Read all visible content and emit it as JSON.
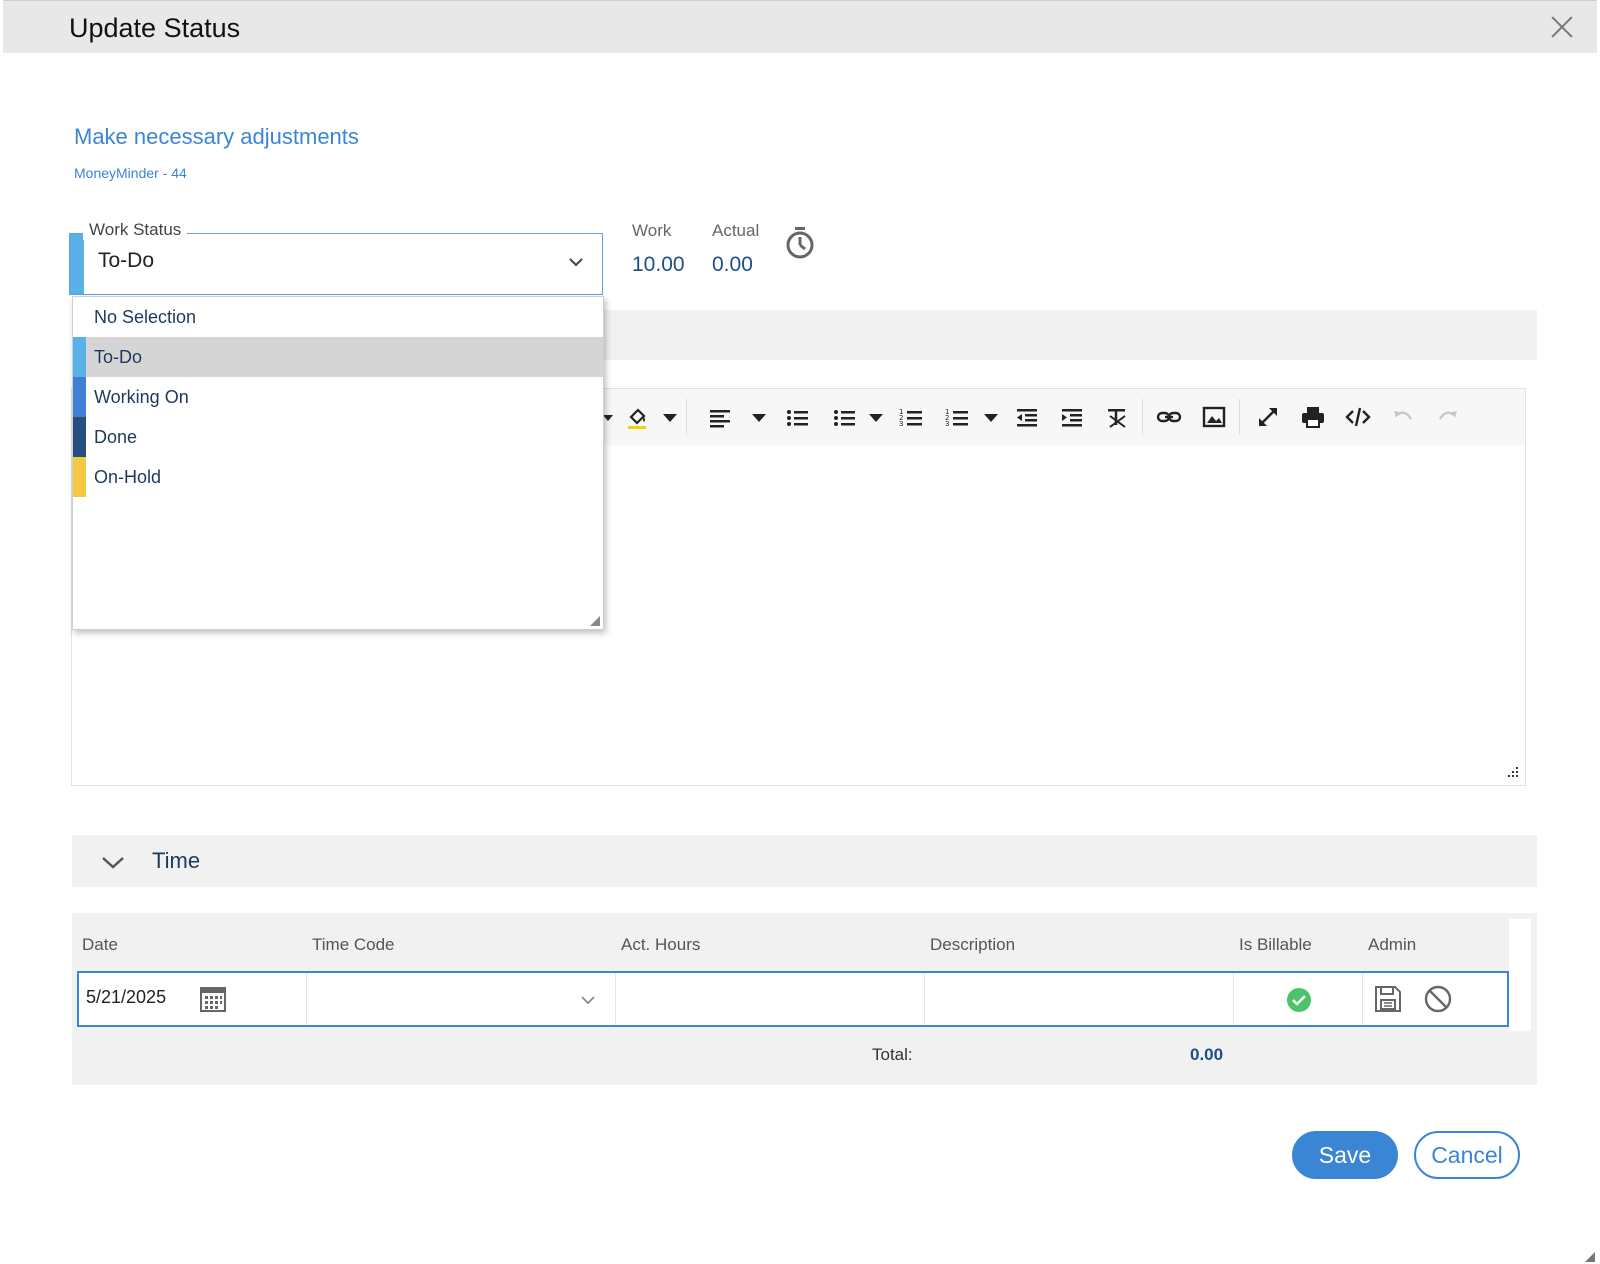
{
  "dialog": {
    "title": "Update Status"
  },
  "task": {
    "name": "Make necessary adjustments",
    "project_ref": "MoneyMinder - 44"
  },
  "work_status": {
    "legend": "Work Status",
    "selected": "To-Do",
    "selected_color": "#5ab0e8",
    "options": [
      {
        "label": "No Selection",
        "color": ""
      },
      {
        "label": "To-Do",
        "color": "#5ab0e8"
      },
      {
        "label": "Working On",
        "color": "#3f7fd6"
      },
      {
        "label": "Done",
        "color": "#264f80"
      },
      {
        "label": "On-Hold",
        "color": "#f5c842"
      }
    ]
  },
  "hours": {
    "work_label": "Work",
    "work_value": "10.00",
    "actual_label": "Actual",
    "actual_value": "0.00"
  },
  "editor": {
    "toolbar_icons": [
      "fill-color-icon",
      "align-left-icon",
      "bullet-list-icon",
      "bullet-list-style-icon",
      "numbered-list-icon",
      "numbered-list-style-icon",
      "outdent-icon",
      "indent-icon",
      "clear-format-icon",
      "link-icon",
      "image-icon",
      "fullscreen-icon",
      "print-icon",
      "code-view-icon",
      "undo-icon",
      "redo-icon"
    ]
  },
  "time_section": {
    "title": "Time",
    "columns": [
      "Date",
      "Time Code",
      "Act. Hours",
      "Description",
      "Is Billable",
      "Admin"
    ],
    "row": {
      "date": "5/21/2025",
      "time_code": "",
      "act_hours": "",
      "description": "",
      "is_billable": true
    },
    "total_label": "Total:",
    "total_value": "0.00"
  },
  "actions": {
    "save_label": "Save",
    "cancel_label": "Cancel"
  },
  "colors": {
    "accent": "#3a86d4",
    "billable_check": "#4cc36a"
  }
}
